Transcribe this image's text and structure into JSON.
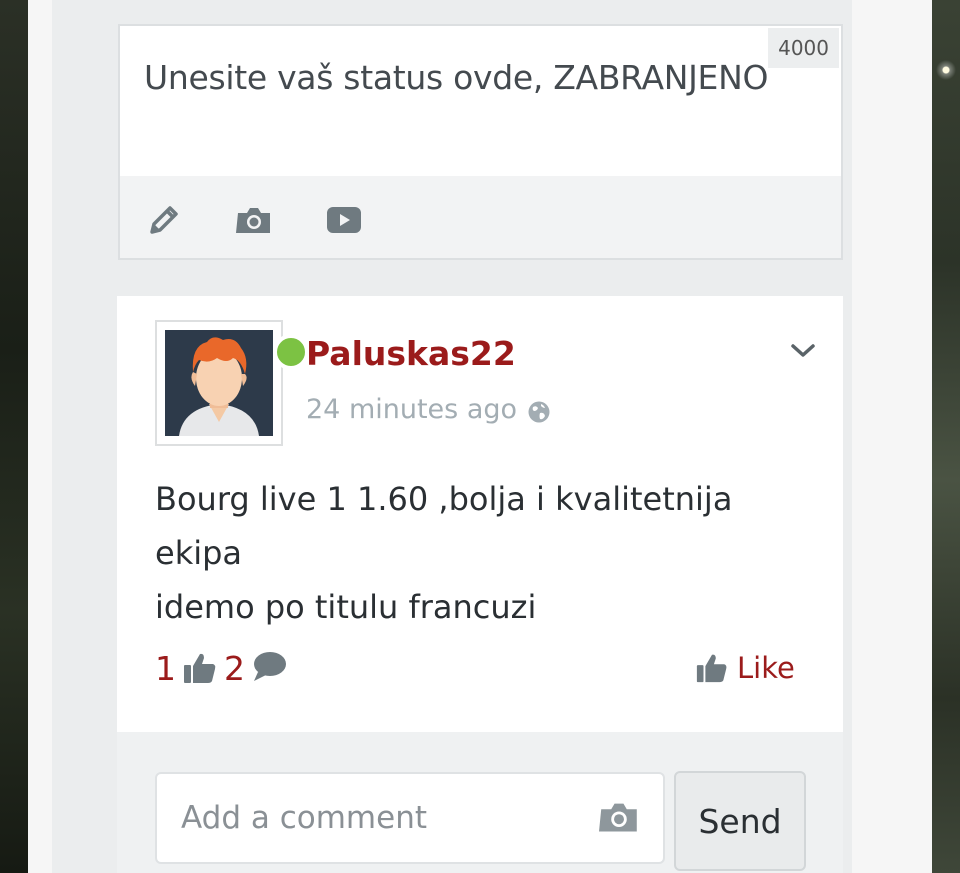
{
  "composer": {
    "placeholder": "Unesite vaš status ovde, ZABRANJENO",
    "char_limit": "4000",
    "tools": [
      {
        "icon": "pencil-icon"
      },
      {
        "icon": "camera-icon"
      },
      {
        "icon": "video-play-icon"
      }
    ]
  },
  "post": {
    "username": "Paluskas22",
    "time": "24 minutes ago",
    "privacy_icon": "globe-icon",
    "online": true,
    "body_line1": "Bourg live 1 1.60 ,bolja i kvalitetnija ekipa",
    "body_line2": "idemo po titulu francuzi",
    "like_count": "1",
    "comment_count": "2",
    "like_label": "Like"
  },
  "comment": {
    "placeholder": "Add a comment",
    "send_label": "Send"
  },
  "colors": {
    "accent": "#9b1b1b",
    "online": "#7cc243",
    "muted": "#a3adb3",
    "icon_gray": "#6f7a80"
  }
}
